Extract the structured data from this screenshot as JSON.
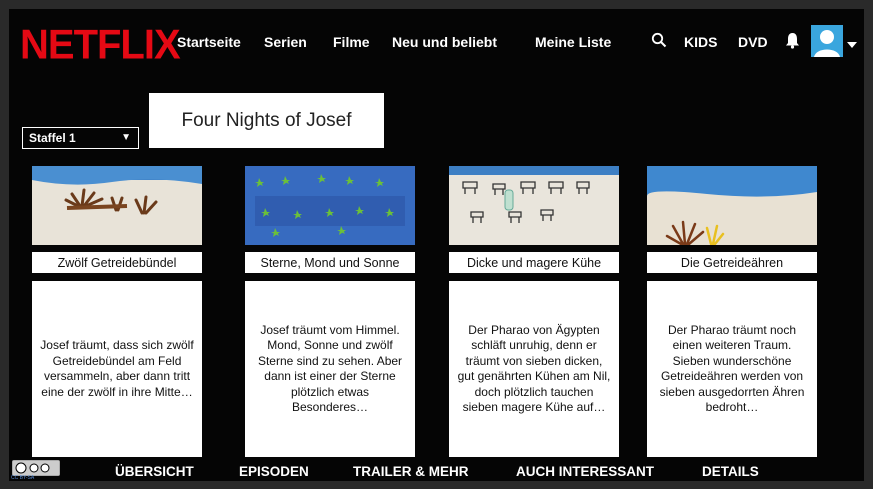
{
  "app": {
    "logo": "NETFLIX"
  },
  "header": {
    "nav": [
      "Startseite",
      "Serien",
      "Filme",
      "Neu und beliebt",
      "Meine Liste"
    ],
    "kids": "KIDS",
    "dvd": "DVD"
  },
  "season_select": {
    "value": "Staffel 1"
  },
  "show": {
    "title": "Four Nights of Josef"
  },
  "episodes": [
    {
      "title": "Zwölf Getreidebündel",
      "description": "Josef träumt, dass sich zwölf Getreidebündel am Feld versammeln, aber dann tritt eine der zwölf in ihre Mitte…"
    },
    {
      "title": "Sterne, Mond und Sonne",
      "description": "Josef träumt vom Himmel. Mond, Sonne und zwölf Sterne sind zu sehen. Aber dann ist einer der Sterne plötzlich etwas Besonderes…"
    },
    {
      "title": "Dicke und magere Kühe",
      "description": "Der Pharao von Ägypten schläft unruhig, denn er träumt von sieben dicken, gut genährten Kühen am Nil, doch plötzlich tauchen sieben magere Kühe auf…"
    },
    {
      "title": "Die Getreideähren",
      "description": "Der Pharao träumt noch einen weiteren Traum. Sieben wunderschöne Getreideähren werden von sieben ausgedorrten Ähren bedroht…"
    }
  ],
  "bottom_tabs": [
    "ÜBERSICHT",
    "EPISODEN",
    "TRAILER & MEHR",
    "AUCH INTERESSANT",
    "DETAILS"
  ],
  "license_text": "CC BY-SA",
  "colors": {
    "brand": "#e50914",
    "background": "#050505",
    "avatar": "#3aa6de"
  }
}
